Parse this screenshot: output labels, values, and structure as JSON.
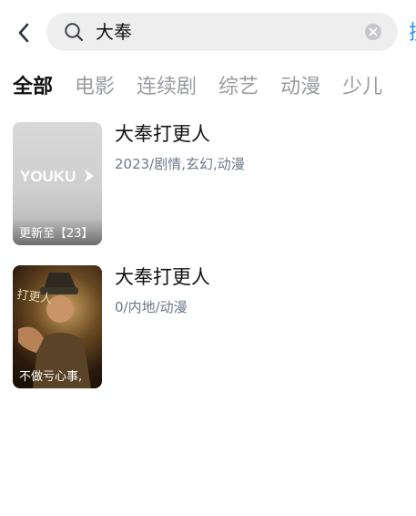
{
  "header": {
    "search_value": "大奉",
    "right_action_label": "搜"
  },
  "tabs": [
    {
      "label": "全部",
      "active": true
    },
    {
      "label": "电影",
      "active": false
    },
    {
      "label": "连续剧",
      "active": false
    },
    {
      "label": "综艺",
      "active": false
    },
    {
      "label": "动漫",
      "active": false
    },
    {
      "label": "少儿",
      "active": false
    }
  ],
  "results": [
    {
      "title": "大奉打更人",
      "meta": "2023/剧情,玄幻,动漫",
      "poster_caption": "更新至【23】",
      "poster_logo": "YOUKU"
    },
    {
      "title": "大奉打更人",
      "meta": "0/内地/动漫",
      "poster_caption": "不做亏心事,",
      "poster_art_text": "打更人"
    }
  ],
  "colors": {
    "accent": "#2a8cf0",
    "search_bg": "#eeeeef",
    "meta_text": "#6b7a8c",
    "tab_inactive": "#999ba1"
  }
}
